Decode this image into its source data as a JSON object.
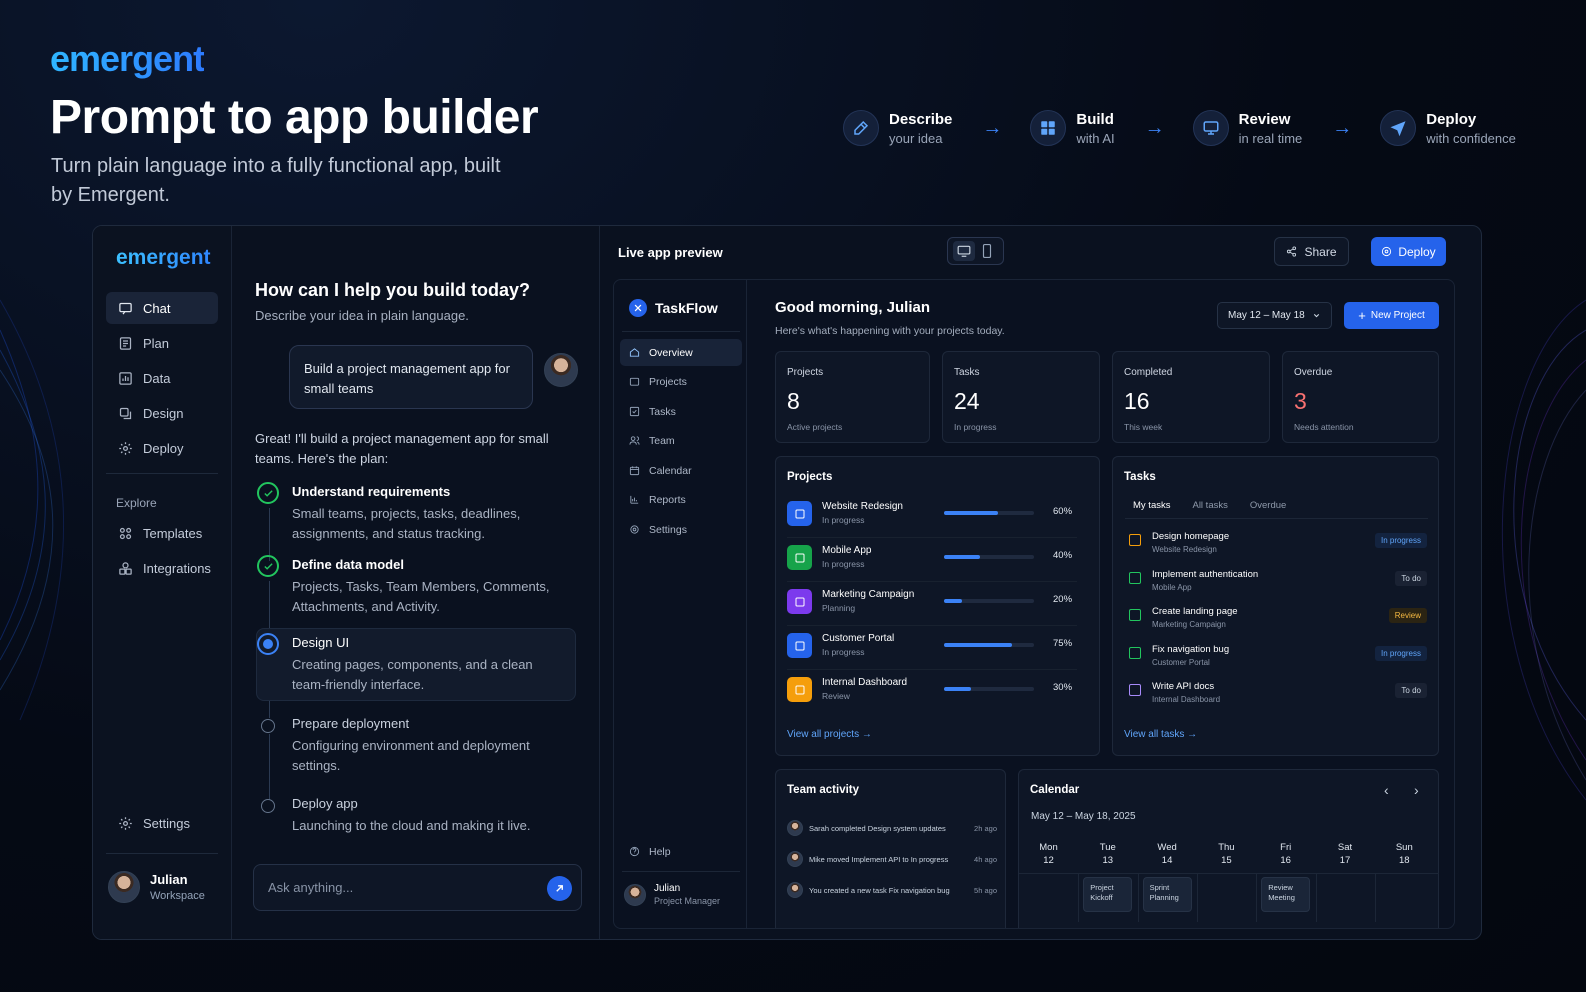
{
  "brand": "emergent",
  "hero": {
    "title": "Prompt to app builder",
    "subtitle": "Turn plain language into a fully functional app, built by Emergent."
  },
  "steps": [
    {
      "title": "Describe",
      "sub": "your idea",
      "icon": "wand-icon"
    },
    {
      "title": "Build",
      "sub": "with AI",
      "icon": "grid-icon"
    },
    {
      "title": "Review",
      "sub": "in real time",
      "icon": "monitor-icon"
    },
    {
      "title": "Deploy",
      "sub": "with confidence",
      "icon": "paper-plane-icon"
    }
  ],
  "builder": {
    "brand": "emergent",
    "nav": [
      "Chat",
      "Plan",
      "Data",
      "Design",
      "Deploy"
    ],
    "explore_label": "Explore",
    "explore": [
      "Templates",
      "Integrations"
    ],
    "settings": "Settings",
    "user": {
      "name": "Julian",
      "role": "Workspace"
    }
  },
  "chat": {
    "heading": "How can I help you build today?",
    "subheading": "Describe your idea in plain language.",
    "user_message": "Build a project management app for small teams",
    "reply": "Great! I'll build a project management app for small teams. Here's the plan:",
    "plan": [
      {
        "title": "Understand requirements",
        "desc": "Small teams, projects, tasks, deadlines, assignments, and status tracking.",
        "status": "done"
      },
      {
        "title": "Define data model",
        "desc": "Projects, Tasks, Team Members, Comments, Attachments, and Activity.",
        "status": "done"
      },
      {
        "title": "Design UI",
        "desc": "Creating pages, components, and a clean team-friendly interface.",
        "status": "current"
      },
      {
        "title": "Prepare deployment",
        "desc": "Configuring environment and deployment settings.",
        "status": "pending"
      },
      {
        "title": "Deploy app",
        "desc": "Launching to the cloud and making it live.",
        "status": "pending"
      }
    ],
    "input_placeholder": "Ask anything..."
  },
  "preview": {
    "title": "Live app preview",
    "share": "Share",
    "deploy": "Deploy"
  },
  "app": {
    "name": "TaskFlow",
    "nav": [
      "Overview",
      "Projects",
      "Tasks",
      "Team",
      "Calendar",
      "Reports",
      "Settings"
    ],
    "help": "Help",
    "user": {
      "name": "Julian",
      "role": "Project Manager"
    },
    "greeting": "Good morning, Julian",
    "greeting_sub": "Here's what's happening with your projects today.",
    "date_range": "May 12 – May 18",
    "new_project": "New Project",
    "stats": [
      {
        "label": "Projects",
        "value": "8",
        "sub": "Active projects",
        "color": "#ffffff"
      },
      {
        "label": "Tasks",
        "value": "24",
        "sub": "In progress",
        "color": "#ffffff"
      },
      {
        "label": "Completed",
        "value": "16",
        "sub": "This week",
        "color": "#ffffff"
      },
      {
        "label": "Overdue",
        "value": "3",
        "sub": "Needs attention",
        "color": "#f87171"
      }
    ],
    "projects_title": "Projects",
    "projects": [
      {
        "name": "Website Redesign",
        "status": "In progress",
        "progress": 60,
        "progress_label": "60%",
        "color": "#2563eb"
      },
      {
        "name": "Mobile App",
        "status": "In progress",
        "progress": 40,
        "progress_label": "40%",
        "color": "#16a34a"
      },
      {
        "name": "Marketing Campaign",
        "status": "Planning",
        "progress": 20,
        "progress_label": "20%",
        "color": "#7c3aed"
      },
      {
        "name": "Customer Portal",
        "status": "In progress",
        "progress": 75,
        "progress_label": "75%",
        "color": "#2563eb"
      },
      {
        "name": "Internal Dashboard",
        "status": "Review",
        "progress": 30,
        "progress_label": "30%",
        "color": "#f59e0b"
      }
    ],
    "view_projects": "View all projects →",
    "tasks_title": "Tasks",
    "task_tabs": [
      "My tasks",
      "All tasks",
      "Overdue"
    ],
    "tasks": [
      {
        "name": "Design homepage",
        "project": "Website Redesign",
        "badge": "In progress",
        "kind": "prog",
        "color": "#f59e0b"
      },
      {
        "name": "Implement authentication",
        "project": "Mobile App",
        "badge": "To do",
        "kind": "todo",
        "color": "#22c55e"
      },
      {
        "name": "Create landing page",
        "project": "Marketing Campaign",
        "badge": "Review",
        "kind": "rev",
        "color": "#22c55e"
      },
      {
        "name": "Fix navigation bug",
        "project": "Customer Portal",
        "badge": "In progress",
        "kind": "prog",
        "color": "#22c55e"
      },
      {
        "name": "Write API docs",
        "project": "Internal Dashboard",
        "badge": "To do",
        "kind": "todo",
        "color": "#a78bfa"
      }
    ],
    "view_tasks": "View all tasks →",
    "activity_title": "Team activity",
    "activity": [
      {
        "text": "Sarah completed Design system updates",
        "time": "2h ago"
      },
      {
        "text": "Mike moved Implement API to In progress",
        "time": "4h ago"
      },
      {
        "text": "You created a new task Fix navigation bug",
        "time": "5h ago"
      }
    ],
    "calendar_title": "Calendar",
    "calendar_range": "May 12 – May 18, 2025",
    "days": [
      {
        "d": "Mon",
        "n": "12"
      },
      {
        "d": "Tue",
        "n": "13"
      },
      {
        "d": "Wed",
        "n": "14"
      },
      {
        "d": "Thu",
        "n": "15"
      },
      {
        "d": "Fri",
        "n": "16"
      },
      {
        "d": "Sat",
        "n": "17"
      },
      {
        "d": "Sun",
        "n": "18"
      }
    ],
    "events": [
      {
        "day": 1,
        "title": "Project Kickoff"
      },
      {
        "day": 2,
        "title": "Sprint Planning"
      },
      {
        "day": 4,
        "title": "Review Meeting"
      }
    ]
  }
}
